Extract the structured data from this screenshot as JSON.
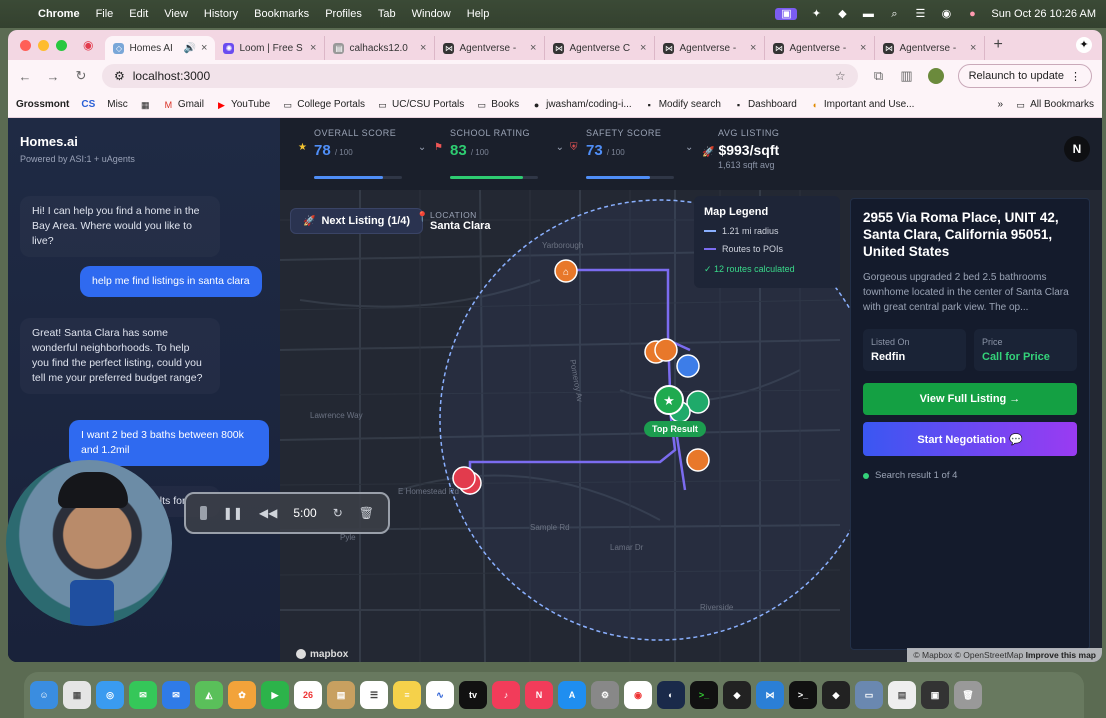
{
  "menubar": {
    "app": "Chrome",
    "items": [
      "File",
      "Edit",
      "View",
      "History",
      "Bookmarks",
      "Profiles",
      "Tab",
      "Window",
      "Help"
    ],
    "clock": "Sun Oct 26  10:26 AM"
  },
  "browser": {
    "tabs": [
      {
        "title": "Homes AI",
        "active": true
      },
      {
        "title": "Loom | Free S"
      },
      {
        "title": "calhacks12.0"
      },
      {
        "title": "Agentverse -"
      },
      {
        "title": "Agentverse C"
      },
      {
        "title": "Agentverse -"
      },
      {
        "title": "Agentverse -"
      },
      {
        "title": "Agentverse -"
      }
    ],
    "url": "localhost:3000",
    "relaunch_label": "Relaunch to update",
    "bookmarks": [
      "Grossmont",
      "CS",
      "Misc",
      "Gmail",
      "YouTube",
      "College Portals",
      "UC/CSU Portals",
      "Books",
      "jwasham/coding-i...",
      "Modify search",
      "Dashboard",
      "Important and Use..."
    ],
    "all_bookmarks": "All Bookmarks"
  },
  "sidebar": {
    "title": "Homes.ai",
    "subtitle": "Powered by ASI:1 + uAgents",
    "messages": [
      {
        "role": "bot",
        "text": "Hi! I can help you find a home in the Bay Area. Where would you like to live?"
      },
      {
        "role": "user",
        "text": "help me find listings in santa clara"
      },
      {
        "role": "bot",
        "text": "Great! Santa Clara has some wonderful neighborhoods. To help you find the perfect listing, could you tell me your preferred budget range?"
      },
      {
        "role": "user",
        "text": "I want 2 bed 3 baths between 800k and 1.2mil"
      },
      {
        "role": "bot",
        "text": "Here ... rty listings in S... sults for"
      }
    ]
  },
  "recorder": {
    "time": "5:00"
  },
  "stats": {
    "overall": {
      "label": "OVERALL SCORE",
      "value": "78",
      "max": "/ 100",
      "fraction": 0.78,
      "color": "#4f8ef7"
    },
    "school": {
      "label": "SCHOOL RATING",
      "value": "83",
      "max": "/ 100",
      "fraction": 0.83,
      "color": "#2ecc71"
    },
    "safety": {
      "label": "SAFETY SCORE",
      "value": "73",
      "max": "/ 100",
      "fraction": 0.73,
      "color": "#4f8ef7"
    },
    "avg": {
      "label": "AVG LISTING",
      "value": "$993/sqft",
      "sub": "1,613 sqft avg"
    }
  },
  "profile_initial": "N",
  "map": {
    "next_listing": "Next Listing (1/4)",
    "location_label": "LOCATION",
    "location_value": "Santa Clara",
    "legend_title": "Map Legend",
    "legend_radius": "1.21 mi radius",
    "legend_routes": "Routes to POIs",
    "legend_calculated": "✓ 12 routes calculated",
    "top_result": "Top Result",
    "attribution": "© Mapbox © OpenStreetMap",
    "improve": "Improve this map",
    "mapbox_logo": "mapbox",
    "street_labels": [
      "Yarborough",
      "Pomeroy Av",
      "Lawrence Way",
      "E Homestead Rd",
      "Sample Rd",
      "Lamar Dr",
      "Pyle",
      "Riverside"
    ]
  },
  "listing": {
    "address": "2955 Via Roma Place, UNIT 42, Santa Clara, California 95051, United States",
    "description": "Gorgeous upgraded 2 bed 2.5 bathrooms townhome located in the center of Santa Clara with great central park view. The op...",
    "listed_on_label": "Listed On",
    "listed_on_value": "Redfin",
    "price_label": "Price",
    "price_value": "Call for Price",
    "view_button": "View Full Listing →",
    "negotiate_button": "Start Negotiation 💬",
    "result_text": "Search result 1 of 4"
  },
  "colors": {
    "accent_blue": "#2f6af0",
    "green": "#14a043",
    "poi_orange": "#e8782a",
    "route_purple": "#7b6cf0"
  }
}
